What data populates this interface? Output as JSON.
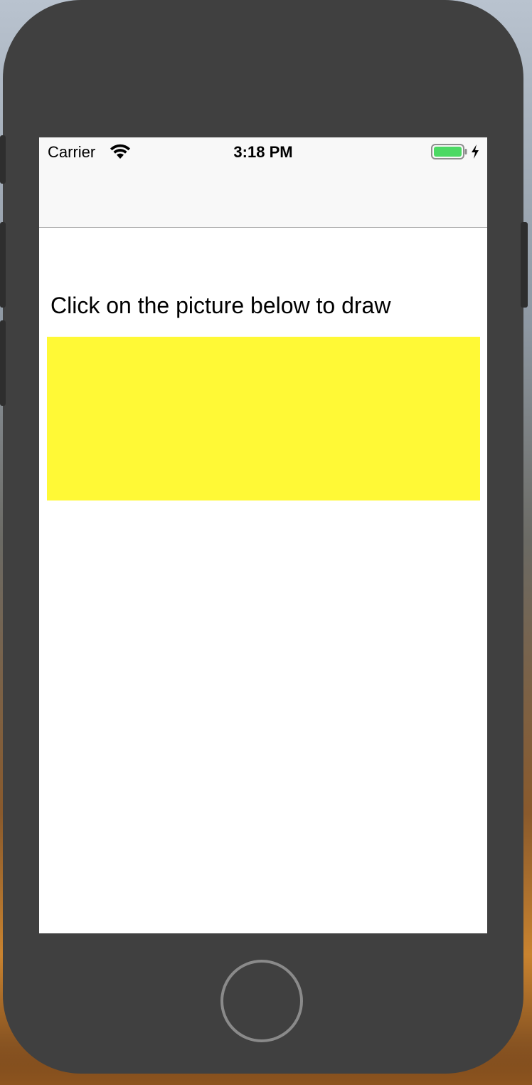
{
  "status_bar": {
    "carrier": "Carrier",
    "time": "3:18 PM",
    "battery_color": "#4cd964",
    "wifi_icon": "wifi-icon",
    "battery_icon": "battery-icon",
    "charging_icon": "lightning-bolt-icon"
  },
  "content": {
    "instruction": "Click on the picture below to draw",
    "drawing_area_color": "#fff936"
  },
  "device": {
    "home_button_icon": "home-button"
  }
}
